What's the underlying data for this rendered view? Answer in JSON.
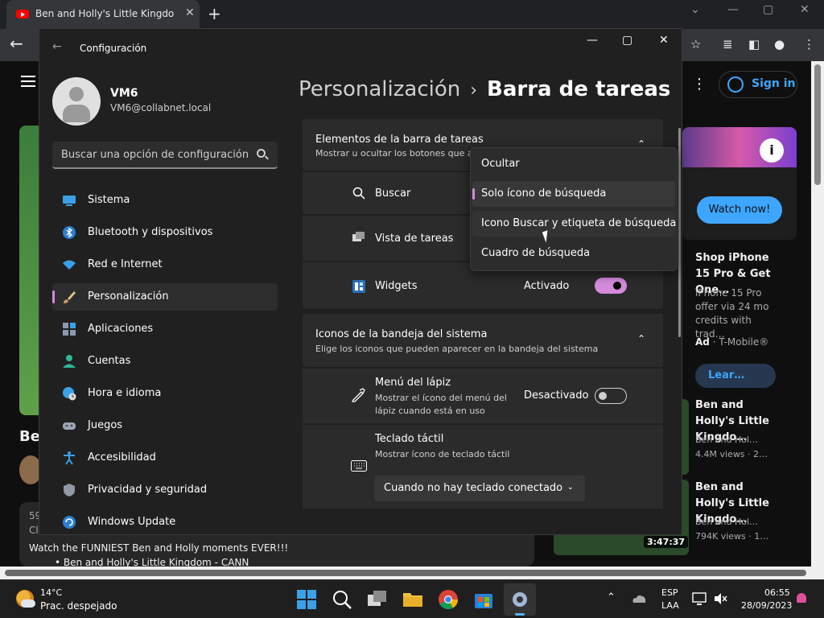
{
  "browser": {
    "tab_title": "Ben and Holly's Little Kingdom |",
    "tab_close": "✕",
    "new_tab": "+",
    "minimize": "—",
    "maximize": "▢",
    "close": "✕",
    "back": "←"
  },
  "youtube": {
    "sign_in": "Sign in",
    "left_title": "Be",
    "description": {
      "line1": "59",
      "line2": "Cl",
      "main": "Watch the FUNNIEST Ben and Holly moments EVER!!!",
      "link": "• Ben and Holly's Little Kingdom - CANN"
    },
    "ad": {
      "info": "i",
      "watch_now": "Watch now!",
      "title": "Shop iPhone 15 Pro & Get One…",
      "desc": "iPhone 15 Pro offer via 24 mo credits with trad…",
      "ad_tag": "Ad",
      "advertiser": "· T-Mobile®",
      "learn": "Lear…"
    },
    "recommendations": [
      {
        "title": "Ben and Holly's Little Kingdo…",
        "channel": "Ben and Hol…",
        "views": "4.4M views · 2…"
      },
      {
        "title": "Ben and Holly's Little Kingdo…",
        "channel": "Ben and Hol…",
        "views": "794K views · 1…"
      }
    ],
    "duration": "3:47:37"
  },
  "settings": {
    "window_title": "Configuración",
    "user": {
      "name": "VM6",
      "email": "VM6@collabnet.local"
    },
    "search_placeholder": "Buscar una opción de configuración",
    "nav": [
      {
        "label": "Sistema",
        "icon": "monitor-icon"
      },
      {
        "label": "Bluetooth y dispositivos",
        "icon": "bluetooth-icon"
      },
      {
        "label": "Red e Internet",
        "icon": "wifi-icon"
      },
      {
        "label": "Personalización",
        "icon": "brush-icon",
        "active": true
      },
      {
        "label": "Aplicaciones",
        "icon": "apps-icon"
      },
      {
        "label": "Cuentas",
        "icon": "person-icon"
      },
      {
        "label": "Hora e idioma",
        "icon": "globe-clock-icon"
      },
      {
        "label": "Juegos",
        "icon": "gamepad-icon"
      },
      {
        "label": "Accesibilidad",
        "icon": "accessibility-icon"
      },
      {
        "label": "Privacidad y seguridad",
        "icon": "shield-icon"
      },
      {
        "label": "Windows Update",
        "icon": "update-icon"
      }
    ],
    "breadcrumb": {
      "parent": "Personalización",
      "sep": "›",
      "current": "Barra de tareas"
    },
    "taskbar_items": {
      "title": "Elementos de la barra de tareas",
      "subtitle": "Mostrar u ocultar los botones que a",
      "search_label": "Buscar",
      "taskview_label": "Vista de tareas",
      "widgets_label": "Widgets",
      "widgets_state": "Activado"
    },
    "tray_icons": {
      "title": "Iconos de la bandeja del sistema",
      "subtitle": "Elige los iconos que pueden aparecer en la bandeja del sistema",
      "pen_label": "Menú del lápiz",
      "pen_desc_1": "Mostrar el ícono del menú del",
      "pen_desc_2": "lápiz cuando está en uso",
      "pen_state": "Desactivado",
      "kbd_label": "Teclado táctil",
      "kbd_desc": "Mostrar ícono de teclado táctil",
      "kbd_value": "Cuando no hay teclado conectado"
    },
    "search_dropdown": {
      "options": [
        "Ocultar",
        "Solo ícono de búsqueda",
        "Icono Buscar y etiqueta de búsqueda",
        "Cuadro de búsqueda"
      ],
      "selected": "Solo ícono de búsqueda"
    },
    "widgets_on": true,
    "pen_on": false
  },
  "taskbar": {
    "temperature": "14°C",
    "condition": "Prac. despejado",
    "lang_1": "ESP",
    "lang_2": "LAA",
    "time": "06:55",
    "date": "28/09/2023"
  },
  "colors": {
    "accent": "#d48bdc",
    "yt_blue": "#3ea6ff",
    "youtube_red": "#ff0000"
  }
}
